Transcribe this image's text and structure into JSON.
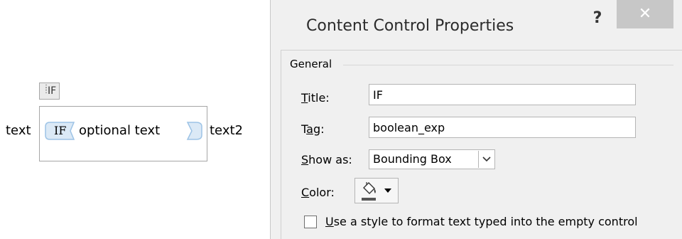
{
  "document": {
    "text_before": "text",
    "text_after": "text2",
    "outer_control_tag": "IF",
    "inner_control_tag": "IF",
    "inner_control_text": "optional text"
  },
  "dialog": {
    "title": "Content Control Properties",
    "help_glyph": "?",
    "close_glyph": "✕",
    "group_general": "General",
    "title_label_mnemonic": "T",
    "title_label_rest": "itle:",
    "title_value": "IF",
    "tag_label_pre": "T",
    "tag_label_mnemonic": "a",
    "tag_label_rest": "g:",
    "tag_value": "boolean_exp",
    "showas_label_mnemonic": "S",
    "showas_label_rest": "how as:",
    "showas_value": "Bounding Box",
    "color_label_mnemonic": "C",
    "color_label_rest": "olor:",
    "style_checkbox_mnemonic": "U",
    "style_checkbox_rest": "se a style to format text typed into the empty control",
    "style_checkbox_checked": false
  },
  "colors": {
    "tag_fill": "#dbe9f6",
    "tag_stroke": "#9dc3e6",
    "close_bg": "#c7c7c7",
    "dialog_bg": "#f0f0f0"
  }
}
